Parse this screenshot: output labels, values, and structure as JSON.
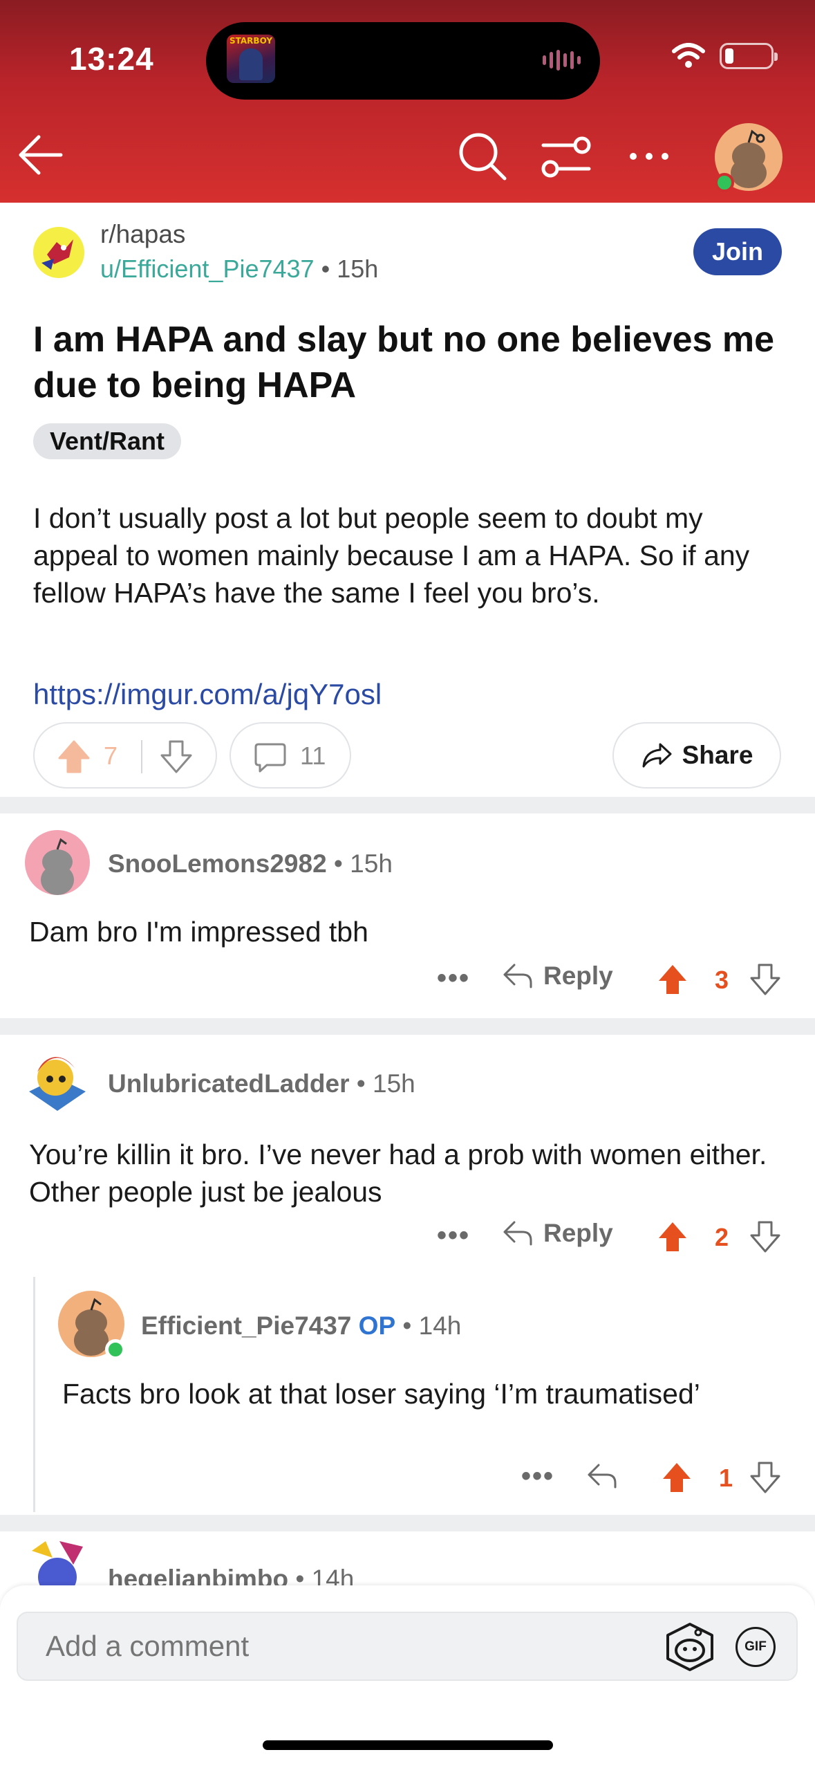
{
  "status_bar": {
    "time": "13:24",
    "album_text": "STARBOY"
  },
  "subreddit": {
    "name": "r/hapas",
    "join_label": "Join"
  },
  "post": {
    "author": "u/Efficient_Pie7437",
    "age": "15h",
    "title": "I am HAPA and slay but no one believes me due to being HAPA",
    "flair": "Vent/Rant",
    "body": "I don’t usually post a lot but people seem to doubt my appeal to women mainly because I am a HAPA. So if any fellow HAPA’s have the same I feel you bro’s.",
    "link": "https://imgur.com/a/jqY7osl",
    "upvotes": "7",
    "comments": "11",
    "share_label": "Share"
  },
  "comments": [
    {
      "author": "SnooLemons2982",
      "age": "15h",
      "text": "Dam bro I'm impressed tbh",
      "reply_label": "Reply",
      "score": "3"
    },
    {
      "author": "UnlubricatedLadder",
      "age": "15h",
      "text": "You’re killin it bro. I’ve never had a prob with women either. Other people just be jealous",
      "reply_label": "Reply",
      "score": "2"
    },
    {
      "author": "Efficient_Pie7437",
      "op_label": "OP",
      "age": "14h",
      "text": "Facts bro look at that loser saying ‘I’m traumatised’",
      "score": "1"
    },
    {
      "author": "hegelianbimbo",
      "age": "14h"
    }
  ],
  "composer": {
    "placeholder": "Add a comment",
    "gif_label": "GIF"
  },
  "colors": {
    "header": "#d6302f",
    "join": "#2a4aa3",
    "upvote_active": "#e5501e",
    "link": "#2a4aa3",
    "op": "#2f74d0"
  }
}
